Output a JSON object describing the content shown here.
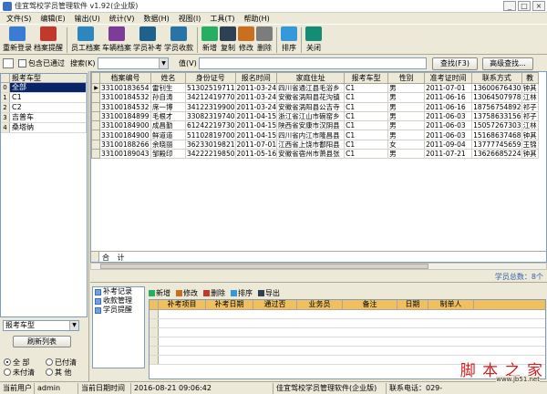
{
  "window": {
    "title": "佳宜驾校学员管理软件 v1.92(企业版)",
    "controls": [
      "_",
      "□",
      "×"
    ]
  },
  "menu": [
    "文件(S)",
    "编辑(E)",
    "输出(U)",
    "统计(V)",
    "数据(H)",
    "视图(I)",
    "工具(T)",
    "帮助(H)"
  ],
  "toolbar": [
    {
      "label": "重新登录",
      "icon": "login-icon",
      "color": "#3a7bd5"
    },
    {
      "label": "档案提醒",
      "icon": "alarm-icon",
      "color": "#c0392b"
    },
    {
      "label": "员工档案",
      "icon": "staff-icon",
      "color": "#2e86c1"
    },
    {
      "label": "车辆档案",
      "icon": "car-icon",
      "color": "#7d3c98"
    },
    {
      "label": "学员补考",
      "icon": "student-icon",
      "color": "#1f618d"
    },
    {
      "label": "学员收款",
      "icon": "payment-icon",
      "color": "#2874a6"
    },
    {
      "label": "新增",
      "icon": "add-icon",
      "color": "#27ae60"
    },
    {
      "label": "复制",
      "icon": "copy-icon",
      "color": "#2e4053"
    },
    {
      "label": "修改",
      "icon": "edit-icon",
      "color": "#ca6f1e"
    },
    {
      "label": "删除",
      "icon": "delete-icon",
      "color": "#7b7d7d"
    },
    {
      "label": "排序",
      "icon": "sort-icon",
      "color": "#3498db"
    },
    {
      "label": "关闭",
      "icon": "exit-icon",
      "color": "#138d75"
    }
  ],
  "search": {
    "include_passed_label": "包含已通过",
    "field_label": "搜索(K)",
    "value_label": "值(V)",
    "field_value": "",
    "value_value": "",
    "find_button": "查找(F3)",
    "advanced_button": "高级查找..."
  },
  "left_panel": {
    "header": "报考车型",
    "rows": [
      {
        "num": "0",
        "label": "全部",
        "selected": true
      },
      {
        "num": "1",
        "label": "C1",
        "selected": false
      },
      {
        "num": "2",
        "label": "C2",
        "selected": false
      },
      {
        "num": "3",
        "label": "吉普车",
        "selected": false
      },
      {
        "num": "4",
        "label": "桑塔纳",
        "selected": false
      }
    ],
    "combo_value": "报考车型",
    "refresh_button": "刷新列表",
    "radio_all": "全 部",
    "radio_paid": "已付清",
    "radio_unpaid": "未付清",
    "radio_other": "其 他"
  },
  "grid": {
    "columns": [
      "档案编号",
      "姓名",
      "身份证号",
      "报名时间",
      "家庭住址",
      "报考车型",
      "性别",
      "准考证时间",
      "联系方式",
      "教"
    ],
    "rows": [
      [
        "33100183654",
        "雷钊生",
        "51302519711",
        "2011-03-24",
        "四川省通江县毛浴乡",
        "C1",
        "男",
        "2011-07-01",
        "13600676430",
        "钟其"
      ],
      [
        "33100184532",
        "孙自涛",
        "34212419770",
        "2011-03-24",
        "安徽省涡阳县花沟镇",
        "C1",
        "男",
        "2011-06-16",
        "13064507978",
        "江林"
      ],
      [
        "33100184532",
        "席一博",
        "34122319900",
        "2011-03-24",
        "安徽省涡阳县公吉寺",
        "C1",
        "男",
        "2011-06-16",
        "18756754892",
        "祁子"
      ],
      [
        "33100184899",
        "毛根才",
        "33082319740",
        "2011-04-15",
        "浙江省江山市碗窑乡",
        "C1",
        "男",
        "2011-06-03",
        "13758633156",
        "祁子"
      ],
      [
        "33100184900",
        "成昌勤",
        "61242219730",
        "2011-04-15",
        "陕西省安康市汉阴县",
        "C1",
        "男",
        "2011-06-03",
        "15057267303",
        "江林"
      ],
      [
        "33100184900",
        "鲜道道",
        "51102819700",
        "2011-04-15",
        "四川省内江市隆昌县",
        "C1",
        "男",
        "2011-06-03",
        "15168637468",
        "钟其"
      ],
      [
        "33100188266",
        "余晓丽",
        "36233019821",
        "2011-07-01",
        "江西省上饶市鄱阳县",
        "C1",
        "女",
        "2011-09-04",
        "13777745659",
        "王锦"
      ],
      [
        "33100189043",
        "邹殿印",
        "34222219850",
        "2011-05-16",
        "安徽省宿州市萧县张",
        "C1",
        "男",
        "2011-07-21",
        "13626685224",
        "钟其"
      ]
    ],
    "total_label": "合 计"
  },
  "summary": {
    "text": "学员总数：8个"
  },
  "sub_panel": {
    "tree": [
      "补考记录",
      "收款管理",
      "学员提醒"
    ],
    "actions": [
      "新增",
      "修改",
      "删除",
      "排序",
      "导出"
    ],
    "columns": [
      "补考项目",
      "补考日期",
      "通过否",
      "业务员",
      "备注",
      "日期",
      "制单人"
    ]
  },
  "status": {
    "user_label": "当前用户",
    "user_value": "admin",
    "date_label": "当前日期时间",
    "datetime": "2016-08-21 09:06:42",
    "company": "佳宜驾校学员管理软件(企业版)",
    "contact_label": "联系电话：029-"
  },
  "watermark": {
    "text": "脚 本 之 家",
    "sub": "www.jb51.net"
  },
  "colors": {
    "selection": "#0a246a",
    "sub_header": "#f0c060",
    "link": "#2f5fb0"
  }
}
